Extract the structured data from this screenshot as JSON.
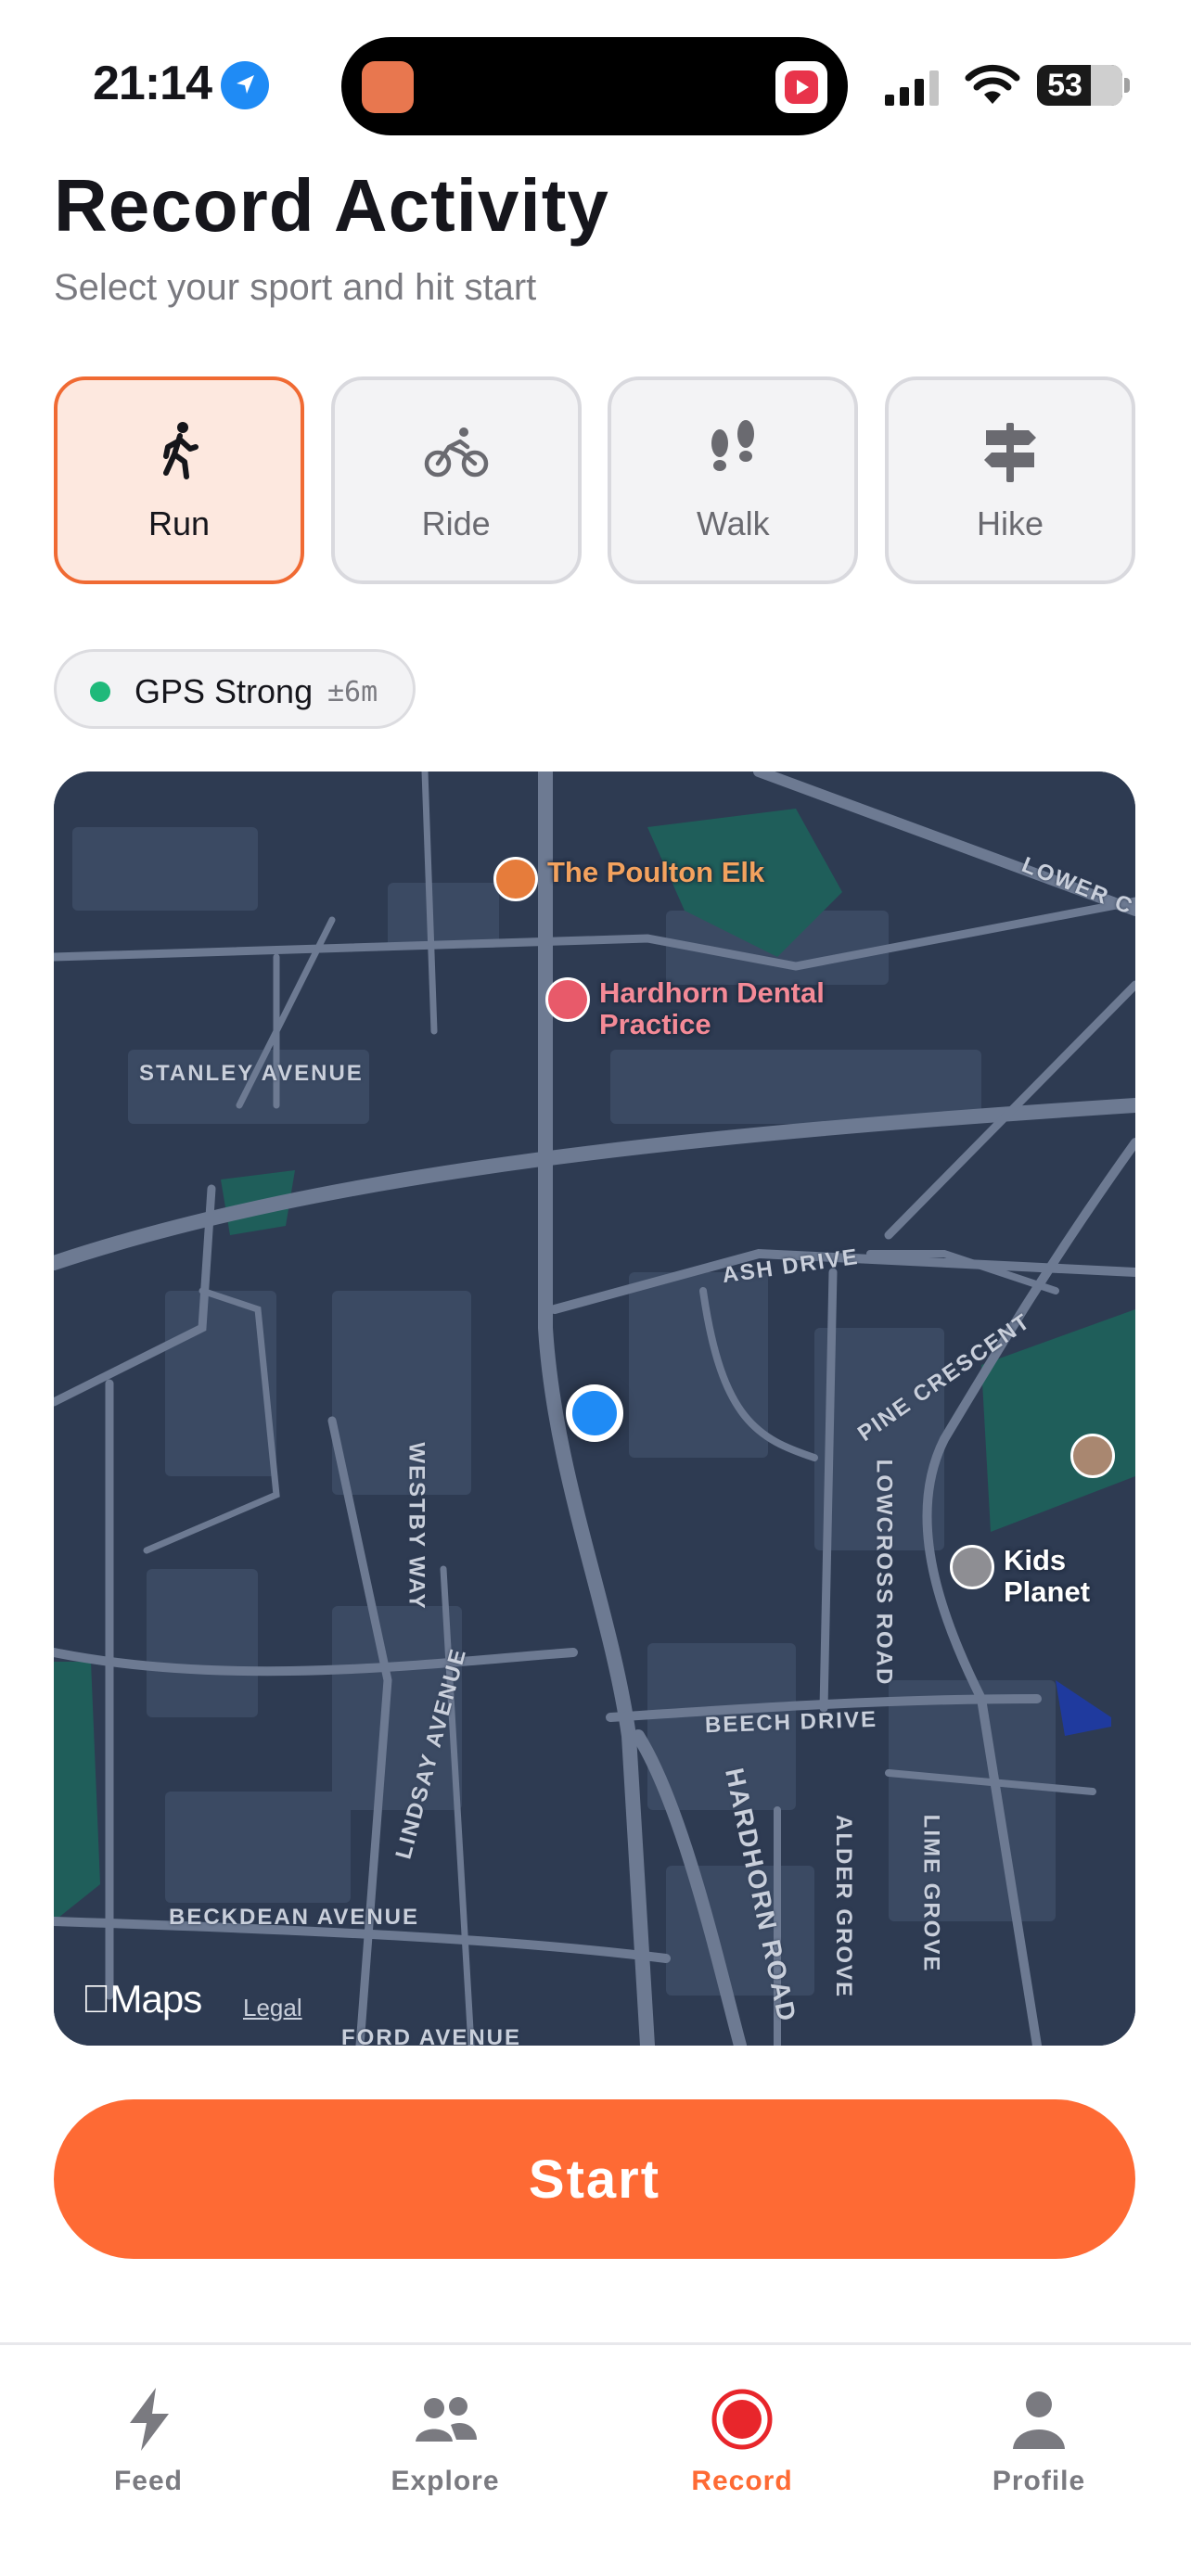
{
  "status_bar": {
    "time": "21:14",
    "battery": "53"
  },
  "header": {
    "title": "Record Activity",
    "subtitle": "Select your sport and hit start"
  },
  "sports": [
    {
      "label": "Run",
      "icon": "run-icon",
      "selected": true
    },
    {
      "label": "Ride",
      "icon": "bike-icon",
      "selected": false
    },
    {
      "label": "Walk",
      "icon": "footprints-icon",
      "selected": false
    },
    {
      "label": "Hike",
      "icon": "signpost-icon",
      "selected": false
    }
  ],
  "gps": {
    "label": "GPS Strong",
    "accuracy": "±6m",
    "status_color": "#1fb97a"
  },
  "map": {
    "pois": {
      "elk": "The Poulton Elk",
      "dental": "Hardhorn Dental Practice",
      "kids": "Kids Planet"
    },
    "roads": {
      "stanley": "STANLEY AVENUE",
      "ash": "ASH DRIVE",
      "pine": "PINE CRESCENT",
      "westby": "WESTBY WAY",
      "lowcross": "LOWCROSS ROAD",
      "beech": "BEECH DRIVE",
      "lindsay": "LINDSAY AVENUE",
      "hardhorn": "HARDHORN ROAD",
      "alder": "ALDER GROVE",
      "lime": "LIME GROVE",
      "beckdean": "BECKDEAN AVENUE",
      "ford": "FORD AVENUE",
      "lower": "LOWER C"
    },
    "brand": "Maps",
    "legal": "Legal"
  },
  "start_button": {
    "label": "Start",
    "color": "#fe6a34"
  },
  "tabs": [
    {
      "label": "Feed",
      "icon": "lightning-icon"
    },
    {
      "label": "Explore",
      "icon": "people-icon"
    },
    {
      "label": "Record",
      "icon": "record-icon",
      "active": true
    },
    {
      "label": "Profile",
      "icon": "person-icon"
    }
  ],
  "colors": {
    "accent": "#fe6a34",
    "selected_card_bg": "#fde8df",
    "map_bg": "#2e3b52"
  }
}
